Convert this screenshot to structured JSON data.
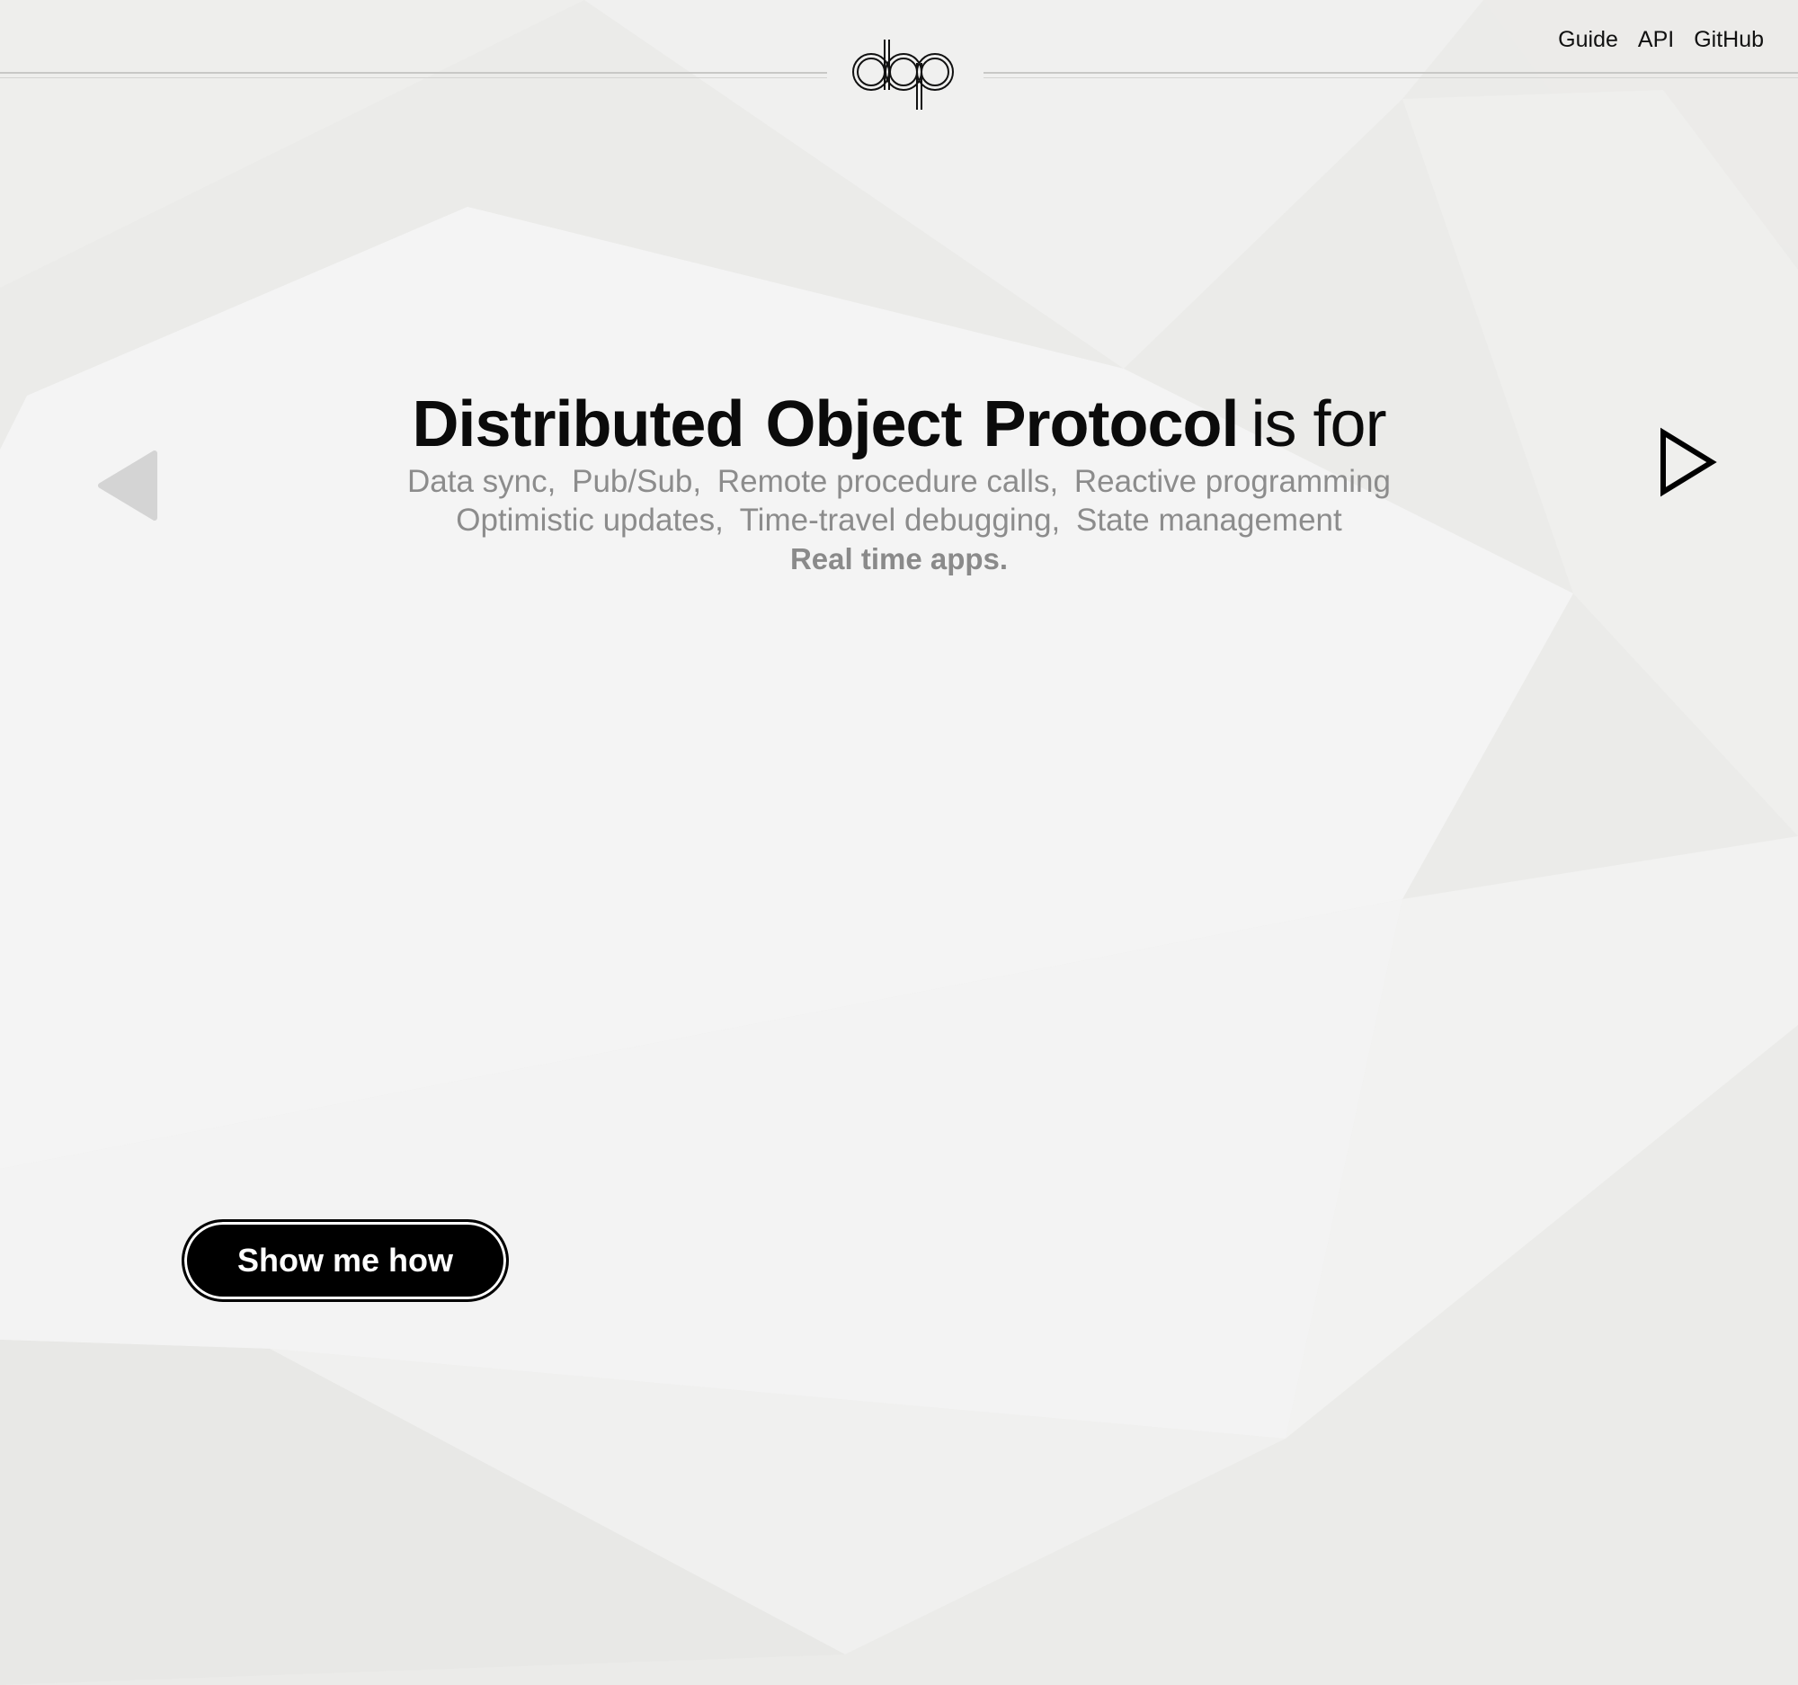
{
  "brand": {
    "logo_text": "dop"
  },
  "nav": {
    "links": [
      {
        "label": "Guide"
      },
      {
        "label": "API"
      },
      {
        "label": "GitHub"
      }
    ]
  },
  "hero": {
    "title_words": [
      "Distributed",
      "Object",
      "Protocol"
    ],
    "title_tail": "is for",
    "feature_lines": [
      [
        "Data sync,",
        "Pub/Sub,",
        "Remote procedure calls,",
        "Reactive programming"
      ],
      [
        "Optimistic updates,",
        "Time-travel debugging,",
        "State management"
      ]
    ],
    "emphasis": "Real time apps."
  },
  "controls": {
    "prev_icon": "triangle-left-icon",
    "next_icon": "triangle-right-outline-icon"
  },
  "cta": {
    "label": "Show me how"
  },
  "colors": {
    "background": "#ebebe9",
    "panel_light": "#f4f4f4",
    "text_dark": "#0b0b0b",
    "text_muted": "#8c8c8c",
    "button_bg": "#000000",
    "button_text": "#ffffff"
  }
}
